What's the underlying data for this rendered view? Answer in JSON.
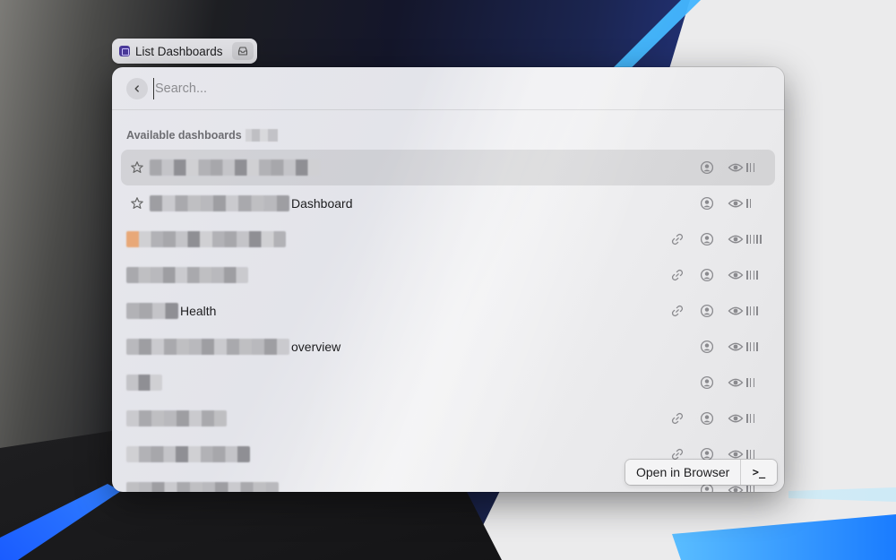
{
  "command_chip": {
    "title": "List Dashboards",
    "app_icon": "grafana-app-icon",
    "trailing_icon": "tray-icon"
  },
  "search": {
    "placeholder": "Search...",
    "value": "",
    "back_icon": "chevron-left-icon"
  },
  "section": {
    "title": "Available dashboards"
  },
  "dashboards": [
    {
      "title": "",
      "blur_width": 190,
      "starred": true,
      "link": false,
      "eye_bars": 3,
      "selected": true
    },
    {
      "title": "Dashboard",
      "blur_width": 156,
      "starred": true,
      "link": false,
      "eye_bars": 2,
      "selected": false
    },
    {
      "title": "",
      "blur_width": 178,
      "starred": false,
      "link": true,
      "eye_bars": 5,
      "selected": false
    },
    {
      "title": "",
      "blur_width": 136,
      "starred": false,
      "link": true,
      "eye_bars": 4,
      "selected": false
    },
    {
      "title": "Health",
      "blur_width": 58,
      "starred": false,
      "link": true,
      "eye_bars": 4,
      "selected": false
    },
    {
      "title": "overview",
      "blur_width": 182,
      "starred": false,
      "link": false,
      "eye_bars": 4,
      "selected": false
    },
    {
      "title": "",
      "blur_width": 40,
      "starred": false,
      "link": false,
      "eye_bars": 3,
      "selected": false
    },
    {
      "title": "",
      "blur_width": 112,
      "starred": false,
      "link": true,
      "eye_bars": 3,
      "selected": false
    },
    {
      "title": "",
      "blur_width": 138,
      "starred": false,
      "link": true,
      "eye_bars": 3,
      "selected": false
    },
    {
      "title": "",
      "blur_width": 170,
      "starred": false,
      "link": false,
      "eye_bars": 3,
      "selected": false
    }
  ],
  "actions": {
    "primary_label": "Open in Browser",
    "secondary_label": ">_"
  },
  "colors": {
    "icon_gray": "#8a8a8e",
    "text": "#1d1d1f"
  }
}
